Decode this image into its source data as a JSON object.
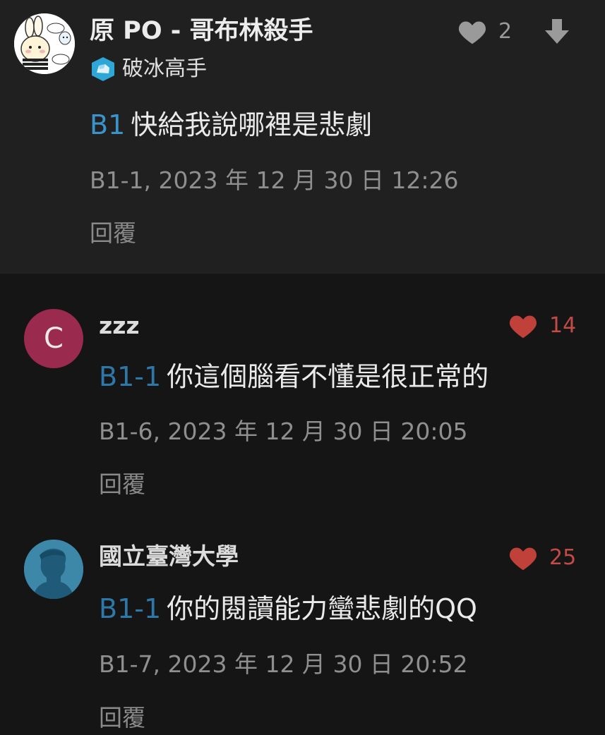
{
  "colors": {
    "background": "#151515",
    "op_background": "#202020",
    "link_blue": "#3a93c9",
    "heart_red": "#c0403a",
    "heart_gray": "#9a9a9a",
    "avatar_c": "#9b2a4f",
    "avatar_school": "#3d87a8"
  },
  "op_comment": {
    "author": "原 PO - 哥布林殺手",
    "badge_icon": "ice-cube-icon",
    "badge_label": "破冰高手",
    "like_icon": "heart-icon",
    "likes": "2",
    "menu_icon": "arrow-down-icon",
    "ref": "B1",
    "text": "快給我說哪裡是悲劇",
    "meta": "B1-1, 2023 年 12 月 30 日 12:26",
    "reply_label": "回覆"
  },
  "replies": [
    {
      "avatar_letter": "C",
      "username": "zzz",
      "likes": "14",
      "ref": "B1-1",
      "text": "你這個腦看不懂是很正常的",
      "meta": "B1-6, 2023 年 12 月 30 日 20:05",
      "reply_label": "回覆"
    },
    {
      "avatar_icon": "school-silhouette-icon",
      "username": "國立臺灣大學",
      "likes": "25",
      "ref": "B1-1",
      "text": "你的閱讀能力蠻悲劇的QQ",
      "meta": "B1-7, 2023 年 12 月 30 日 20:52",
      "reply_label": "回覆"
    }
  ]
}
